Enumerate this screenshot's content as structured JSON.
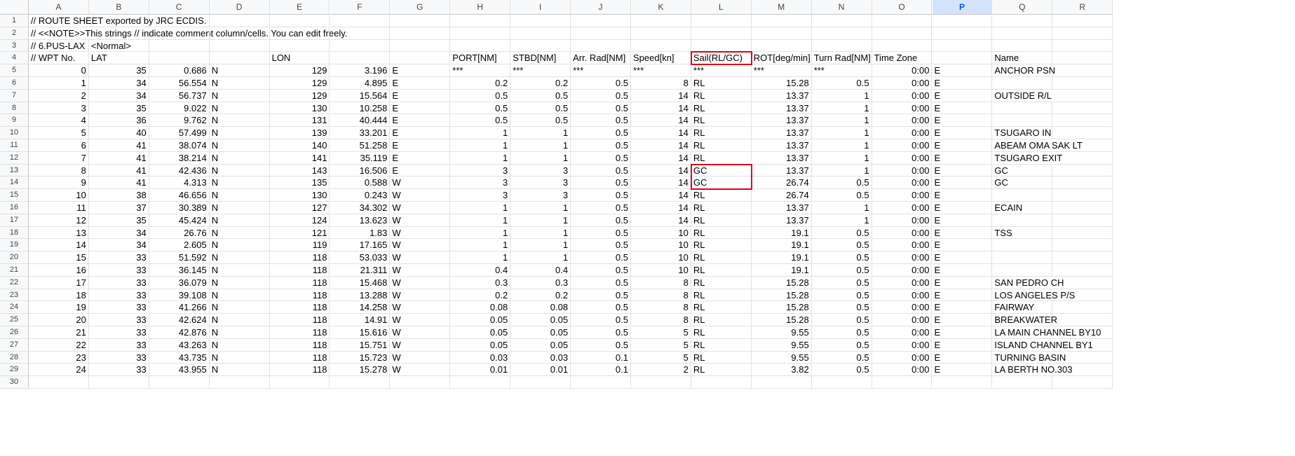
{
  "columns": [
    "A",
    "B",
    "C",
    "D",
    "E",
    "F",
    "G",
    "H",
    "I",
    "J",
    "K",
    "L",
    "M",
    "N",
    "O",
    "P",
    "Q",
    "R"
  ],
  "selected_column": "P",
  "rows": [
    [
      "// ROUTE SHEET exported by JRC ECDIS.",
      "",
      "",
      "",
      "",
      "",
      "",
      "",
      "",
      "",
      "",
      "",
      "",
      "",
      "",
      "",
      "",
      ""
    ],
    [
      "// <<NOTE>>This strings // indicate comment column/cells. You can edit freely.",
      "",
      "",
      "",
      "",
      "",
      "",
      "",
      "",
      "",
      "",
      "",
      "",
      "",
      "",
      "",
      "",
      ""
    ],
    [
      "// 6.PUS-LAX",
      "<Normal>",
      "",
      "",
      "",
      "",
      "",
      "",
      "",
      "",
      "",
      "",
      "",
      "",
      "",
      "",
      "",
      ""
    ],
    [
      "// WPT No.",
      "LAT",
      "",
      "",
      "LON",
      "",
      "",
      "PORT[NM]",
      "STBD[NM]",
      "Arr. Rad[NM]",
      "Speed[kn]",
      "Sail(RL/GC)",
      "ROT[deg/min]",
      "Turn Rad[NM]",
      "Time Zone",
      "",
      "Name",
      ""
    ],
    [
      "0",
      "35",
      "0.686",
      "N",
      "129",
      "3.196",
      "E",
      "***",
      "***",
      "***",
      "***",
      "***",
      "***",
      "***",
      "0:00",
      "E",
      "ANCHOR PSN",
      ""
    ],
    [
      "1",
      "34",
      "56.554",
      "N",
      "129",
      "4.895",
      "E",
      "0.2",
      "0.2",
      "0.5",
      "8",
      "RL",
      "15.28",
      "0.5",
      "0:00",
      "E",
      "",
      ""
    ],
    [
      "2",
      "34",
      "56.737",
      "N",
      "129",
      "15.564",
      "E",
      "0.5",
      "0.5",
      "0.5",
      "14",
      "RL",
      "13.37",
      "1",
      "0:00",
      "E",
      "OUTSIDE R/L",
      ""
    ],
    [
      "3",
      "35",
      "9.022",
      "N",
      "130",
      "10.258",
      "E",
      "0.5",
      "0.5",
      "0.5",
      "14",
      "RL",
      "13.37",
      "1",
      "0:00",
      "E",
      "",
      ""
    ],
    [
      "4",
      "36",
      "9.762",
      "N",
      "131",
      "40.444",
      "E",
      "0.5",
      "0.5",
      "0.5",
      "14",
      "RL",
      "13.37",
      "1",
      "0:00",
      "E",
      "",
      ""
    ],
    [
      "5",
      "40",
      "57.499",
      "N",
      "139",
      "33.201",
      "E",
      "1",
      "1",
      "0.5",
      "14",
      "RL",
      "13.37",
      "1",
      "0:00",
      "E",
      "TSUGARO IN",
      ""
    ],
    [
      "6",
      "41",
      "38.074",
      "N",
      "140",
      "51.258",
      "E",
      "1",
      "1",
      "0.5",
      "14",
      "RL",
      "13.37",
      "1",
      "0:00",
      "E",
      "ABEAM OMA SAK LT",
      ""
    ],
    [
      "7",
      "41",
      "38.214",
      "N",
      "141",
      "35.119",
      "E",
      "1",
      "1",
      "0.5",
      "14",
      "RL",
      "13.37",
      "1",
      "0:00",
      "E",
      "TSUGARO EXIT",
      ""
    ],
    [
      "8",
      "41",
      "42.436",
      "N",
      "143",
      "16.506",
      "E",
      "3",
      "3",
      "0.5",
      "14",
      "GC",
      "13.37",
      "1",
      "0:00",
      "E",
      "GC",
      ""
    ],
    [
      "9",
      "41",
      "4.313",
      "N",
      "135",
      "0.588",
      "W",
      "3",
      "3",
      "0.5",
      "14",
      "GC",
      "26.74",
      "0.5",
      "0:00",
      "E",
      "GC",
      ""
    ],
    [
      "10",
      "38",
      "46.656",
      "N",
      "130",
      "0.243",
      "W",
      "3",
      "3",
      "0.5",
      "14",
      "RL",
      "26.74",
      "0.5",
      "0:00",
      "E",
      "",
      ""
    ],
    [
      "11",
      "37",
      "30.389",
      "N",
      "127",
      "34.302",
      "W",
      "1",
      "1",
      "0.5",
      "14",
      "RL",
      "13.37",
      "1",
      "0:00",
      "E",
      "ECAIN",
      ""
    ],
    [
      "12",
      "35",
      "45.424",
      "N",
      "124",
      "13.623",
      "W",
      "1",
      "1",
      "0.5",
      "14",
      "RL",
      "13.37",
      "1",
      "0:00",
      "E",
      "",
      ""
    ],
    [
      "13",
      "34",
      "26.76",
      "N",
      "121",
      "1.83",
      "W",
      "1",
      "1",
      "0.5",
      "10",
      "RL",
      "19.1",
      "0.5",
      "0:00",
      "E",
      "TSS",
      ""
    ],
    [
      "14",
      "34",
      "2.605",
      "N",
      "119",
      "17.165",
      "W",
      "1",
      "1",
      "0.5",
      "10",
      "RL",
      "19.1",
      "0.5",
      "0:00",
      "E",
      "",
      ""
    ],
    [
      "15",
      "33",
      "51.592",
      "N",
      "118",
      "53.033",
      "W",
      "1",
      "1",
      "0.5",
      "10",
      "RL",
      "19.1",
      "0.5",
      "0:00",
      "E",
      "",
      ""
    ],
    [
      "16",
      "33",
      "36.145",
      "N",
      "118",
      "21.311",
      "W",
      "0.4",
      "0.4",
      "0.5",
      "10",
      "RL",
      "19.1",
      "0.5",
      "0:00",
      "E",
      "",
      ""
    ],
    [
      "17",
      "33",
      "36.079",
      "N",
      "118",
      "15.468",
      "W",
      "0.3",
      "0.3",
      "0.5",
      "8",
      "RL",
      "15.28",
      "0.5",
      "0:00",
      "E",
      "SAN PEDRO CH",
      ""
    ],
    [
      "18",
      "33",
      "39.108",
      "N",
      "118",
      "13.288",
      "W",
      "0.2",
      "0.2",
      "0.5",
      "8",
      "RL",
      "15.28",
      "0.5",
      "0:00",
      "E",
      "LOS ANGELES P/S",
      ""
    ],
    [
      "19",
      "33",
      "41.266",
      "N",
      "118",
      "14.258",
      "W",
      "0.08",
      "0.08",
      "0.5",
      "8",
      "RL",
      "15.28",
      "0.5",
      "0:00",
      "E",
      "FAIRWAY",
      ""
    ],
    [
      "20",
      "33",
      "42.624",
      "N",
      "118",
      "14.91",
      "W",
      "0.05",
      "0.05",
      "0.5",
      "8",
      "RL",
      "15.28",
      "0.5",
      "0:00",
      "E",
      "BREAKWATER",
      ""
    ],
    [
      "21",
      "33",
      "42.876",
      "N",
      "118",
      "15.616",
      "W",
      "0.05",
      "0.05",
      "0.5",
      "5",
      "RL",
      "9.55",
      "0.5",
      "0:00",
      "E",
      "LA MAIN CHANNEL BY10",
      ""
    ],
    [
      "22",
      "33",
      "43.263",
      "N",
      "118",
      "15.751",
      "W",
      "0.05",
      "0.05",
      "0.5",
      "5",
      "RL",
      "9.55",
      "0.5",
      "0:00",
      "E",
      "ISLAND CHANNEL BY1",
      ""
    ],
    [
      "23",
      "33",
      "43.735",
      "N",
      "118",
      "15.723",
      "W",
      "0.03",
      "0.03",
      "0.1",
      "5",
      "RL",
      "9.55",
      "0.5",
      "0:00",
      "E",
      "TURNING BASIN",
      ""
    ],
    [
      "24",
      "33",
      "43.955",
      "N",
      "118",
      "15.278",
      "W",
      "0.01",
      "0.01",
      "0.1",
      "2",
      "RL",
      "3.82",
      "0.5",
      "0:00",
      "E",
      "LA BERTH NO.303",
      ""
    ],
    [
      "",
      "",
      "",
      "",
      "",
      "",
      "",
      "",
      "",
      "",
      "",
      "",
      "",
      "",
      "",
      "",
      "",
      ""
    ]
  ],
  "highlight_color": "#e0001b"
}
